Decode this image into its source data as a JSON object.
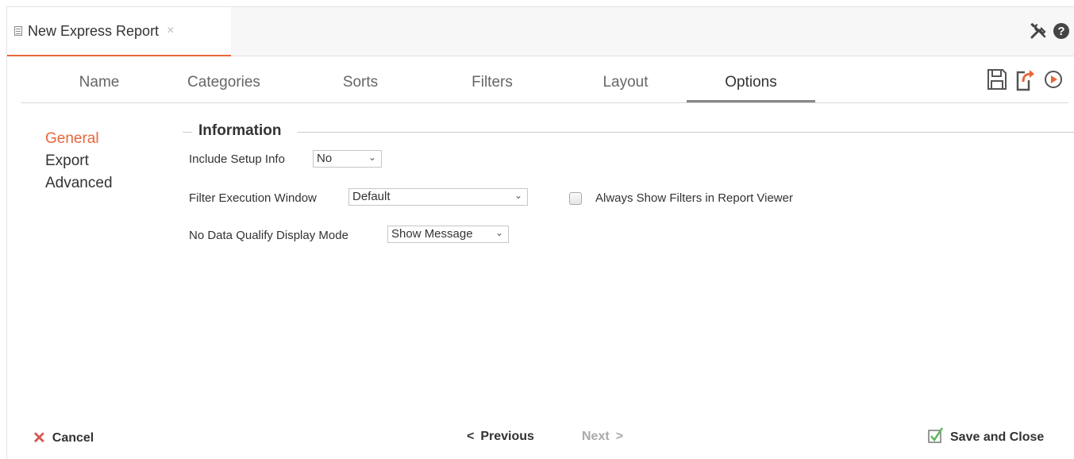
{
  "tab": {
    "title": "New Express Report",
    "close_glyph": "×"
  },
  "header_icons": [
    "tools-icon",
    "help-icon"
  ],
  "steps": [
    {
      "label": "Name",
      "active": false
    },
    {
      "label": "Categories",
      "active": false
    },
    {
      "label": "Sorts",
      "active": false
    },
    {
      "label": "Filters",
      "active": false
    },
    {
      "label": "Layout",
      "active": false
    },
    {
      "label": "Options",
      "active": true
    }
  ],
  "actions": [
    "save-icon",
    "export-icon",
    "run-icon"
  ],
  "side_menu": [
    {
      "label": "General",
      "active": true
    },
    {
      "label": "Export",
      "active": false
    },
    {
      "label": "Advanced",
      "active": false
    }
  ],
  "section": {
    "title": "Information"
  },
  "fields": {
    "include_setup": {
      "label": "Include Setup Info",
      "value": "No"
    },
    "filter_window": {
      "label": "Filter Execution Window",
      "value": "Default"
    },
    "always_show_filters": {
      "label": "Always Show Filters in Report Viewer",
      "checked": false
    },
    "no_data_mode": {
      "label": "No Data Qualify Display Mode",
      "value": "Show Message"
    }
  },
  "footer": {
    "cancel": "Cancel",
    "previous": "Previous",
    "next": "Next",
    "save_close": "Save and Close"
  },
  "colors": {
    "accent": "#e8673a",
    "run_icon": "#e8673a",
    "cancel_icon": "#d9534f",
    "save_check": "#5cb85c"
  }
}
